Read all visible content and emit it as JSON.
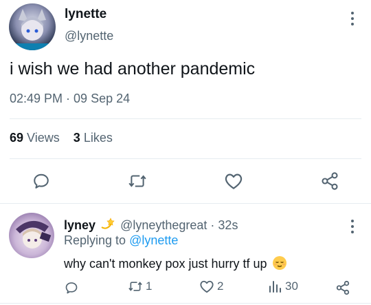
{
  "tweet": {
    "display_name": "lynette",
    "handle": "@lynette",
    "text": "i wish we had another pandemic",
    "timestamp": "02:49 PM · 09 Sep 24",
    "views_count": "69",
    "views_label": "Views",
    "likes_count": "3",
    "likes_label": "Likes"
  },
  "reply": {
    "display_name": "lyney",
    "handle": "@lyneythegreat",
    "time": "· 32s",
    "replying_prefix": "Replying to",
    "replying_to": "@lynette",
    "text": "why can't monkey pox just hurry tf up",
    "retweets": "1",
    "likes": "2",
    "views": "30"
  },
  "colors": {
    "accent": "#1d9bf0",
    "muted": "#536471",
    "text": "#0f1419"
  },
  "icons": [
    "more-vertical-icon",
    "reply-icon",
    "retweet-icon",
    "like-icon",
    "share-icon",
    "views-icon",
    "dizzy-icon",
    "relieved-face-icon"
  ]
}
